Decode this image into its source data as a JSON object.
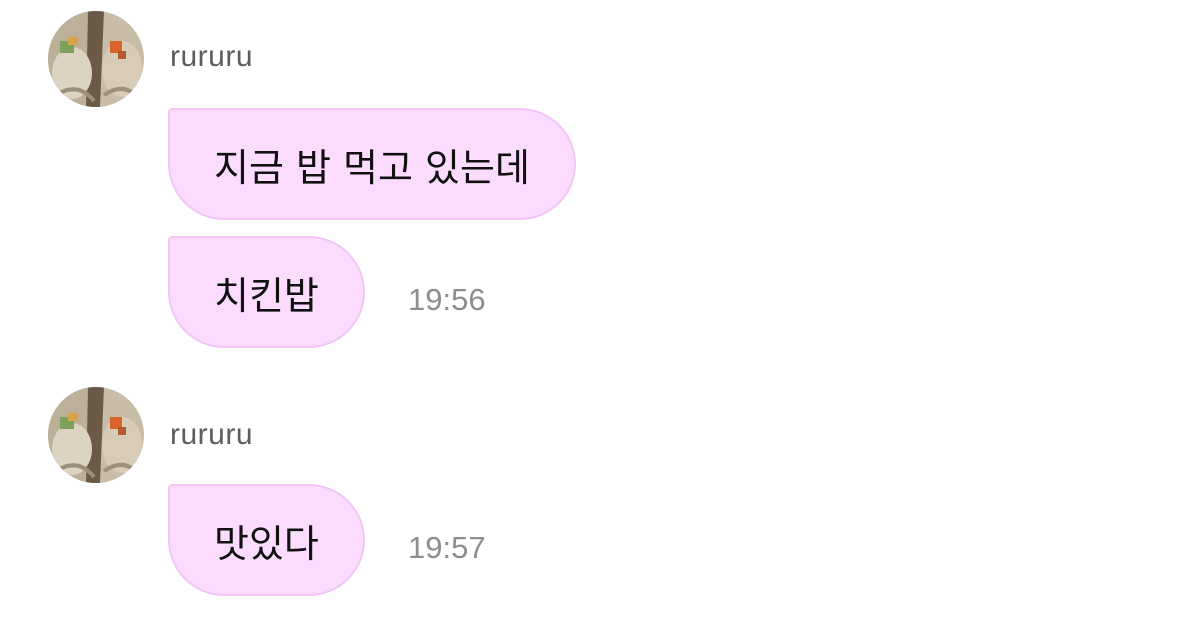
{
  "groups": [
    {
      "sender": "rururu",
      "messages": [
        {
          "text": "지금 밥 먹고 있는데",
          "time": ""
        },
        {
          "text": "치킨밥",
          "time": "19:56"
        }
      ]
    },
    {
      "sender": "rururu",
      "messages": [
        {
          "text": "맛있다",
          "time": "19:57"
        }
      ]
    }
  ],
  "colors": {
    "bubble_fill": "#fbdcff",
    "bubble_border": "#f3c6f7",
    "sender_text": "#5d5d5d",
    "time_text": "#8e8e8e"
  }
}
